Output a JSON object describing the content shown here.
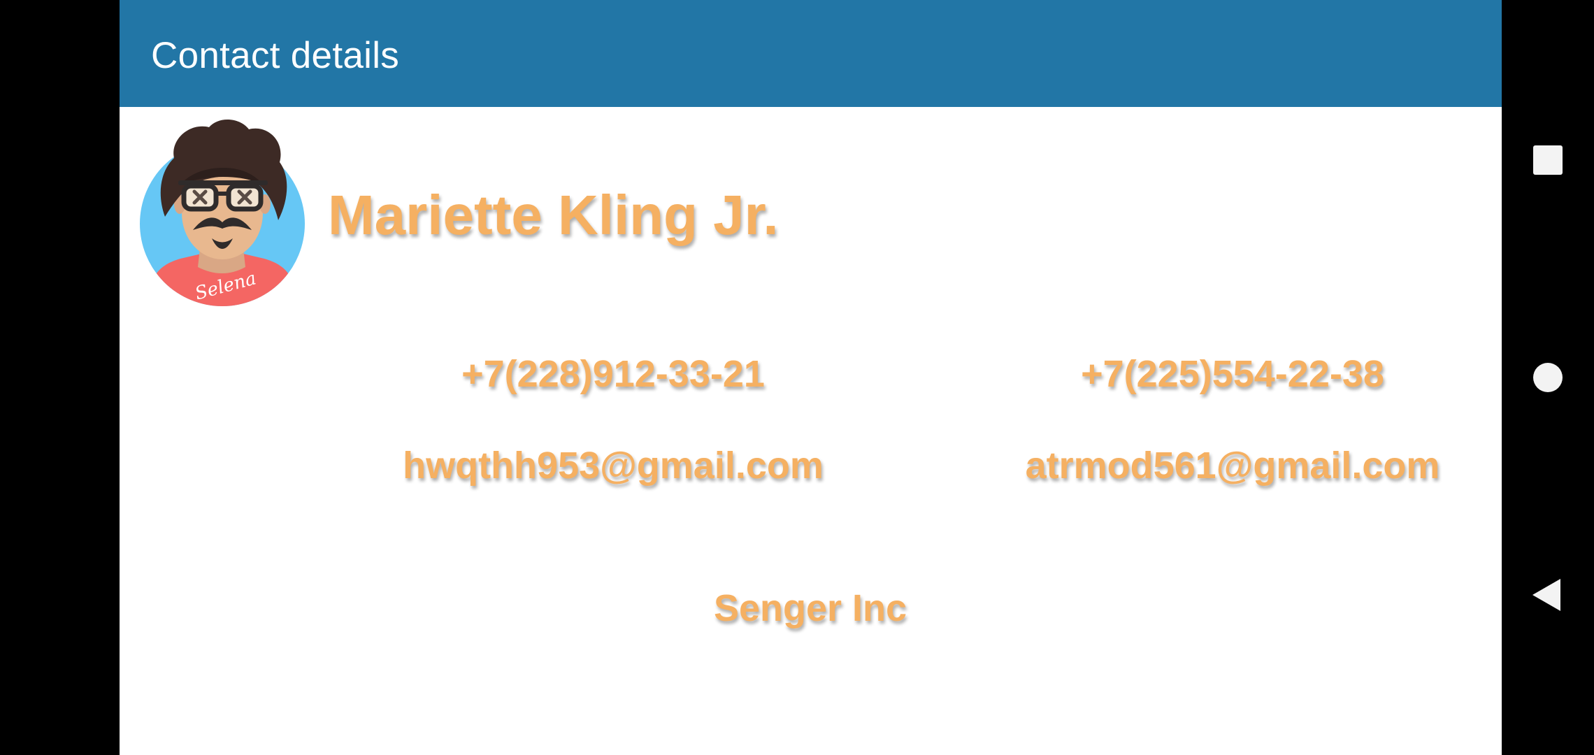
{
  "toolbar": {
    "title": "Contact details",
    "color": "#2276a6"
  },
  "contact": {
    "avatar_icon": "cartoon-avatar-icon",
    "avatar_shirt_text": "Selena",
    "name": "Mariette Kling Jr.",
    "phones": [
      "+7(228)912-33-21",
      "+7(225)554-22-38"
    ],
    "emails": [
      "hwqthh953@gmail.com",
      "atrmod561@gmail.com"
    ],
    "company": "Senger Inc",
    "text_color": "#f5b062"
  },
  "navigation": {
    "recents_icon": "square-icon",
    "home_icon": "circle-icon",
    "back_icon": "triangle-back-icon"
  }
}
